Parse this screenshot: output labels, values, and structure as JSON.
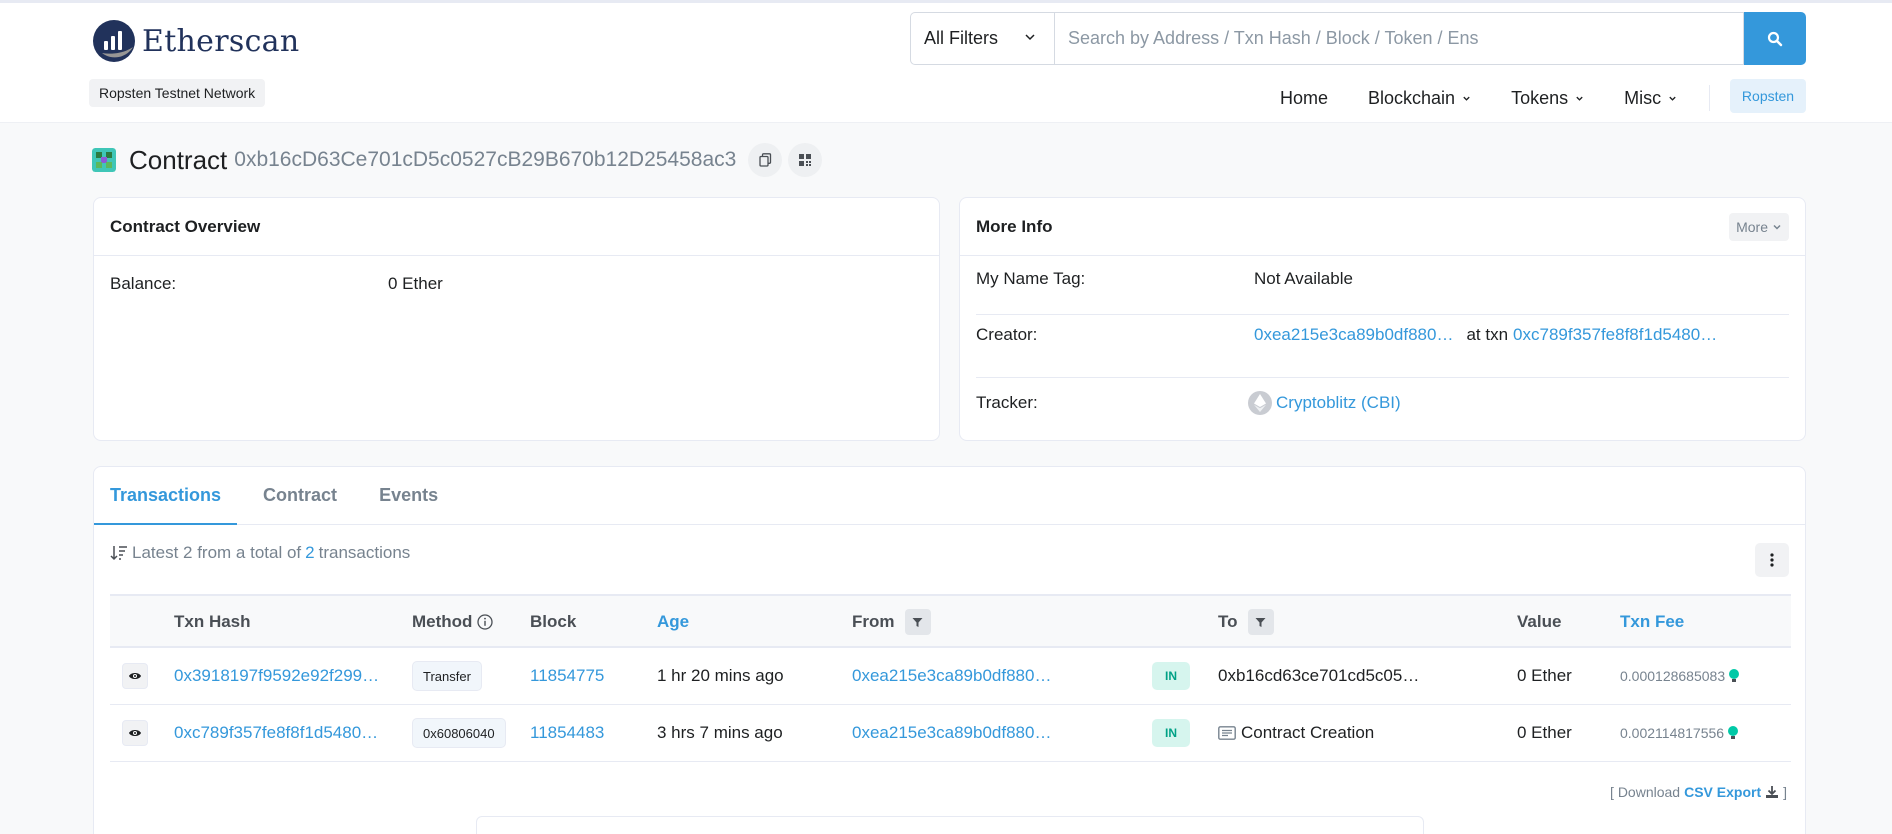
{
  "header": {
    "brand": "Etherscan",
    "network_badge": "Ropsten Testnet Network",
    "search": {
      "filter_label": "All Filters",
      "placeholder": "Search by Address / Txn Hash / Block / Token / Ens"
    },
    "nav": [
      {
        "label": "Home",
        "dropdown": false
      },
      {
        "label": "Blockchain",
        "dropdown": true
      },
      {
        "label": "Tokens",
        "dropdown": true
      },
      {
        "label": "Misc",
        "dropdown": true
      }
    ],
    "network_button": "Ropsten"
  },
  "page": {
    "title_label": "Contract",
    "address": "0xb16cD63Ce701cD5c0527cB29B670b12D25458ac3"
  },
  "overview": {
    "title": "Contract Overview",
    "balance_label": "Balance:",
    "balance_value": "0 Ether"
  },
  "more_info": {
    "title": "More Info",
    "more_button": "More",
    "name_tag_label": "My Name Tag:",
    "name_tag_value": "Not Available",
    "creator_label": "Creator:",
    "creator_address": "0xea215e3ca89b0df880…",
    "creator_at_txn": "at txn",
    "creator_txn": "0xc789f357fe8f8f1d5480…",
    "tracker_label": "Tracker:",
    "tracker_value": "Cryptoblitz (CBI)"
  },
  "tabs": [
    {
      "label": "Transactions",
      "active": true
    },
    {
      "label": "Contract",
      "active": false
    },
    {
      "label": "Events",
      "active": false
    }
  ],
  "summary": {
    "prefix": "Latest 2 from a total of",
    "count": "2",
    "suffix": "transactions"
  },
  "table": {
    "columns": [
      "Txn Hash",
      "Method",
      "Block",
      "Age",
      "From",
      "To",
      "Value",
      "Txn Fee"
    ],
    "rows": [
      {
        "hash": "0x3918197f9592e92f299…",
        "method": "Transfer",
        "block": "11854775",
        "age": "1 hr 20 mins ago",
        "from": "0xea215e3ca89b0df880…",
        "direction": "IN",
        "to": "0xb16cd63ce701cd5c05…",
        "value": "0 Ether",
        "fee": "0.000128685083"
      },
      {
        "hash": "0xc789f357fe8f8f1d5480…",
        "method": "0x60806040",
        "block": "11854483",
        "age": "3 hrs 7 mins ago",
        "from": "0xea215e3ca89b0df880…",
        "direction": "IN",
        "to": "Contract Creation",
        "value": "0 Ether",
        "fee": "0.002114817556"
      }
    ]
  },
  "csv": {
    "open": "[ Download",
    "link": "CSV Export",
    "close": "]"
  },
  "colors": {
    "accent": "#3498db",
    "in_badge_bg": "#d6f5ee",
    "in_badge_text": "#00a186",
    "muted_text": "#77838f"
  }
}
